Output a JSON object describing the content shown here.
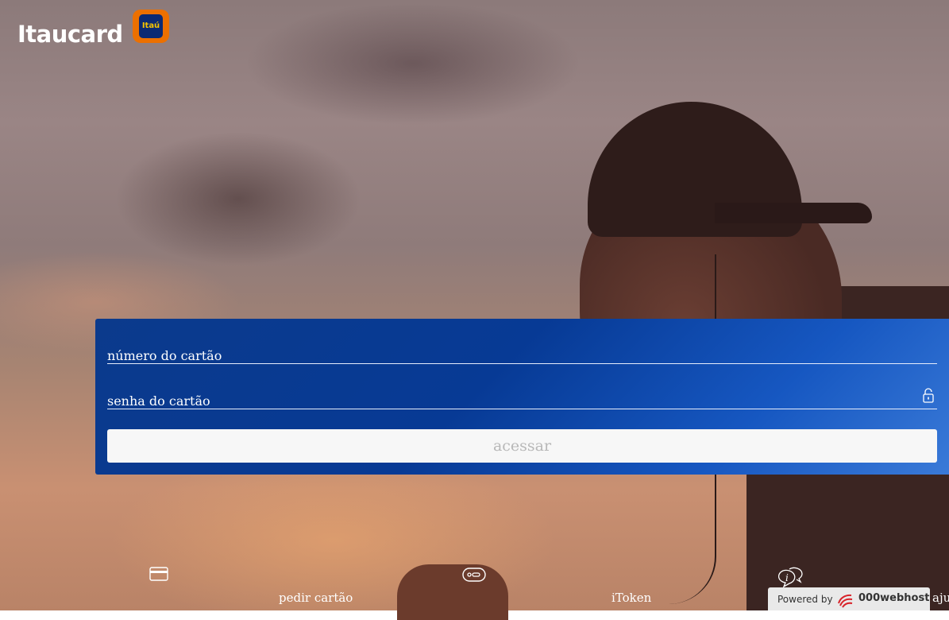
{
  "brand": {
    "name": "Itaucard",
    "badge": "Itaú",
    "colors": {
      "orange": "#ec7000",
      "blue": "#0b2a73",
      "yellow": "#f6c400"
    }
  },
  "login": {
    "card_number_placeholder": "número do cartão",
    "password_placeholder": "senha do cartão",
    "submit_label": "acessar",
    "panel_color": "#073a95"
  },
  "nav": {
    "items": [
      {
        "label": "pedir cartão",
        "icon": "credit-card-icon"
      },
      {
        "label": "iToken",
        "icon": "token-icon"
      },
      {
        "label": "aju",
        "icon": "help-chat-icon"
      }
    ]
  },
  "footer_badge": {
    "label": "Powered by",
    "brand": "000webhost"
  }
}
